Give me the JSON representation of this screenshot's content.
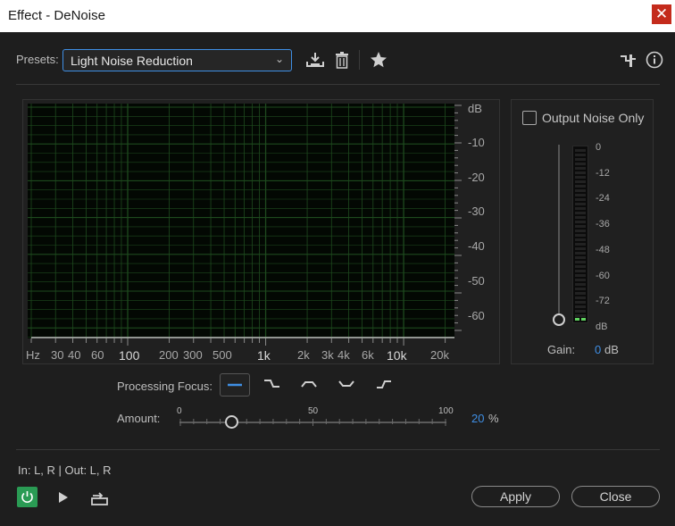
{
  "window": {
    "title": "Effect - DeNoise",
    "close_glyph": "✕"
  },
  "presets": {
    "label": "Presets:",
    "selected": "Light Noise Reduction",
    "caret": "⌄"
  },
  "toolbar_icons": [
    "download-preset-icon",
    "trash-icon",
    "star-icon",
    "routing-icon",
    "info-icon"
  ],
  "graph": {
    "db_unit": "dB",
    "db_labels": [
      "-10",
      "-20",
      "-30",
      "-40",
      "-50",
      "-60"
    ],
    "freq_labels": [
      "Hz",
      "30",
      "40",
      "60",
      "100",
      "200",
      "300",
      "500",
      "1k",
      "2k",
      "3k",
      "4k",
      "6k",
      "10k",
      "20k"
    ]
  },
  "output": {
    "only_label": "Output Noise Only",
    "checked": false,
    "meter_labels": [
      "0",
      "-12",
      "-24",
      "-36",
      "-48",
      "-60",
      "-72",
      "dB"
    ],
    "gain_label": "Gain:",
    "gain_value": "0",
    "gain_unit": "dB"
  },
  "processing": {
    "label": "Processing Focus:",
    "options": [
      "focus-flat-icon",
      "focus-high-cut-icon",
      "focus-mid-bump-icon",
      "focus-mid-dip-icon",
      "focus-low-cut-icon"
    ],
    "active_index": 0
  },
  "amount": {
    "label": "Amount:",
    "scale": [
      "0",
      "50",
      "100"
    ],
    "value": "20",
    "unit": "%",
    "fraction": 0.2
  },
  "io": {
    "label": "In: L, R | Out: L, R"
  },
  "footer": {
    "apply_label": "Apply",
    "close_label": "Close"
  },
  "colors": {
    "accent": "#3f8fe5",
    "power_on": "#2a9b54",
    "grid": "#1e4a1e",
    "close_red": "#c42b1c"
  }
}
